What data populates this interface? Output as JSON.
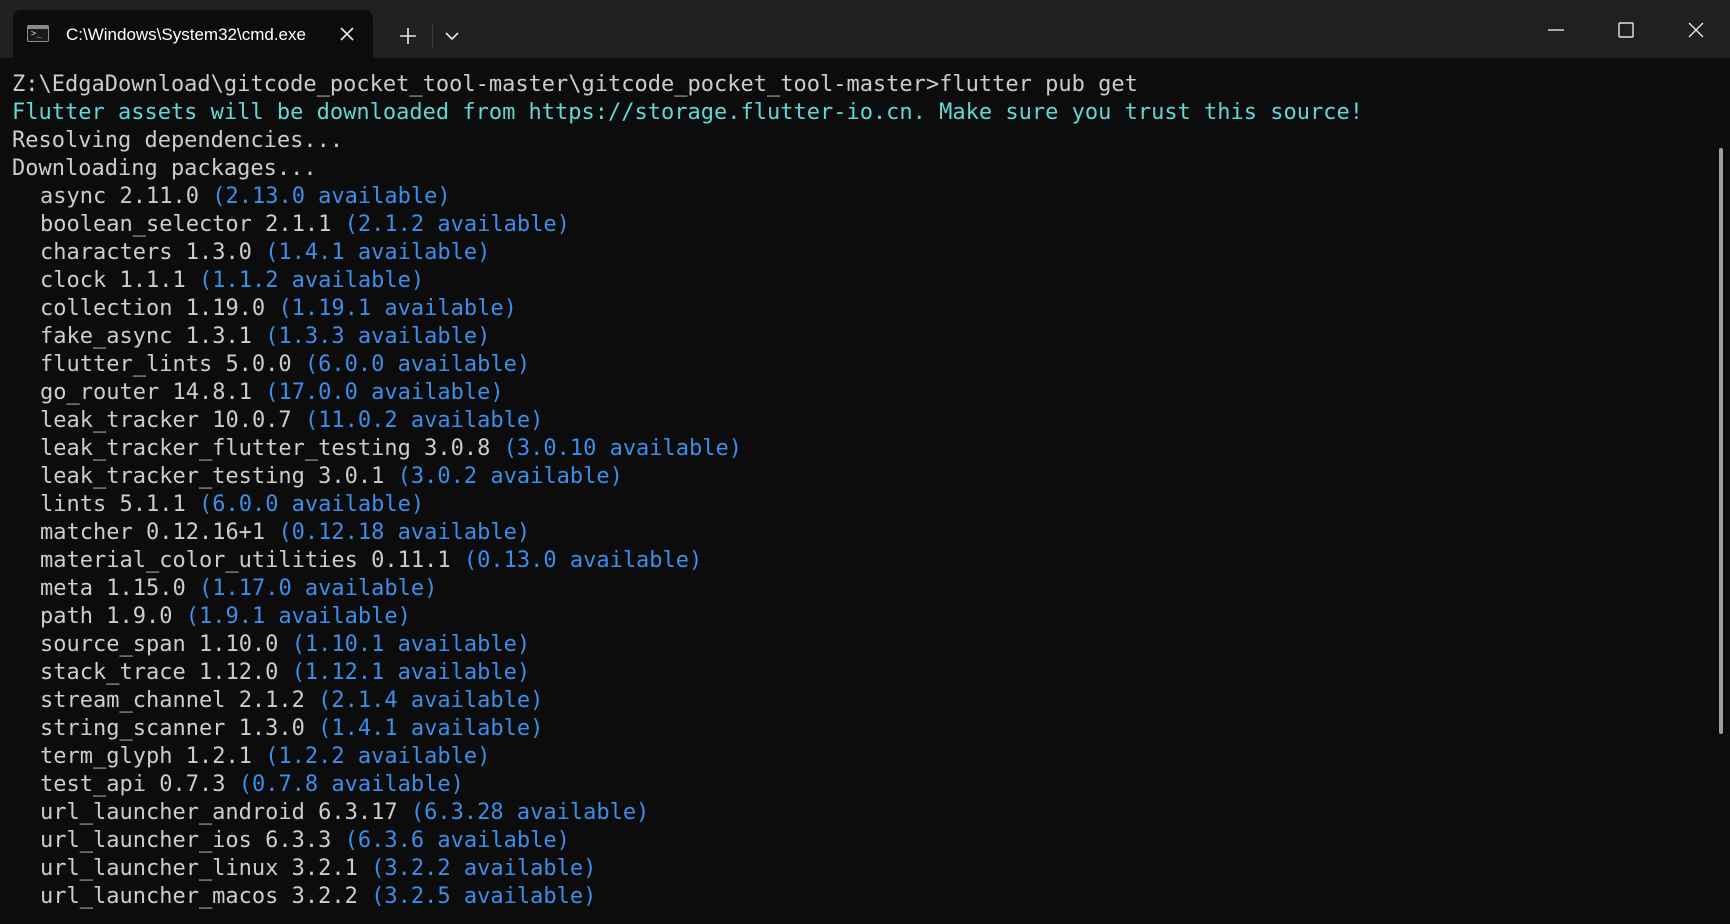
{
  "window": {
    "tab_title": "C:\\Windows\\System32\\cmd.exe",
    "tab_icon_glyph": ">_"
  },
  "terminal": {
    "command_line": "Z:\\EdgaDownload\\gitcode_pocket_tool-master\\gitcode_pocket_tool-master>flutter pub get",
    "notice_line": "Flutter assets will be downloaded from https://storage.flutter-io.cn. Make sure you trust this source!",
    "status_lines": [
      "Resolving dependencies...",
      "Downloading packages..."
    ],
    "packages": [
      {
        "name": "async",
        "version": "2.11.0",
        "available": "(2.13.0 available)"
      },
      {
        "name": "boolean_selector",
        "version": "2.1.1",
        "available": "(2.1.2 available)"
      },
      {
        "name": "characters",
        "version": "1.3.0",
        "available": "(1.4.1 available)"
      },
      {
        "name": "clock",
        "version": "1.1.1",
        "available": "(1.1.2 available)"
      },
      {
        "name": "collection",
        "version": "1.19.0",
        "available": "(1.19.1 available)"
      },
      {
        "name": "fake_async",
        "version": "1.3.1",
        "available": "(1.3.3 available)"
      },
      {
        "name": "flutter_lints",
        "version": "5.0.0",
        "available": "(6.0.0 available)"
      },
      {
        "name": "go_router",
        "version": "14.8.1",
        "available": "(17.0.0 available)"
      },
      {
        "name": "leak_tracker",
        "version": "10.0.7",
        "available": "(11.0.2 available)"
      },
      {
        "name": "leak_tracker_flutter_testing",
        "version": "3.0.8",
        "available": "(3.0.10 available)"
      },
      {
        "name": "leak_tracker_testing",
        "version": "3.0.1",
        "available": "(3.0.2 available)"
      },
      {
        "name": "lints",
        "version": "5.1.1",
        "available": "(6.0.0 available)"
      },
      {
        "name": "matcher",
        "version": "0.12.16+1",
        "available": "(0.12.18 available)"
      },
      {
        "name": "material_color_utilities",
        "version": "0.11.1",
        "available": "(0.13.0 available)"
      },
      {
        "name": "meta",
        "version": "1.15.0",
        "available": "(1.17.0 available)"
      },
      {
        "name": "path",
        "version": "1.9.0",
        "available": "(1.9.1 available)"
      },
      {
        "name": "source_span",
        "version": "1.10.0",
        "available": "(1.10.1 available)"
      },
      {
        "name": "stack_trace",
        "version": "1.12.0",
        "available": "(1.12.1 available)"
      },
      {
        "name": "stream_channel",
        "version": "2.1.2",
        "available": "(2.1.4 available)"
      },
      {
        "name": "string_scanner",
        "version": "1.3.0",
        "available": "(1.4.1 available)"
      },
      {
        "name": "term_glyph",
        "version": "1.2.1",
        "available": "(1.2.2 available)"
      },
      {
        "name": "test_api",
        "version": "0.7.3",
        "available": "(0.7.8 available)"
      },
      {
        "name": "url_launcher_android",
        "version": "6.3.17",
        "available": "(6.3.28 available)"
      },
      {
        "name": "url_launcher_ios",
        "version": "6.3.3",
        "available": "(6.3.6 available)"
      },
      {
        "name": "url_launcher_linux",
        "version": "3.2.1",
        "available": "(3.2.2 available)"
      },
      {
        "name": "url_launcher_macos",
        "version": "3.2.2",
        "available": "(3.2.5 available)"
      }
    ]
  },
  "icons": {
    "tab_close": "close-icon",
    "new_tab": "plus-icon",
    "tab_dropdown": "chevron-down-icon",
    "minimize": "minimize-icon",
    "maximize": "maximize-icon",
    "close": "close-icon"
  },
  "colors": {
    "background": "#0c0c0c",
    "titlebar": "#202020",
    "text": "#cccccc",
    "cyan": "#61d6d6",
    "blue": "#3b8eea"
  }
}
